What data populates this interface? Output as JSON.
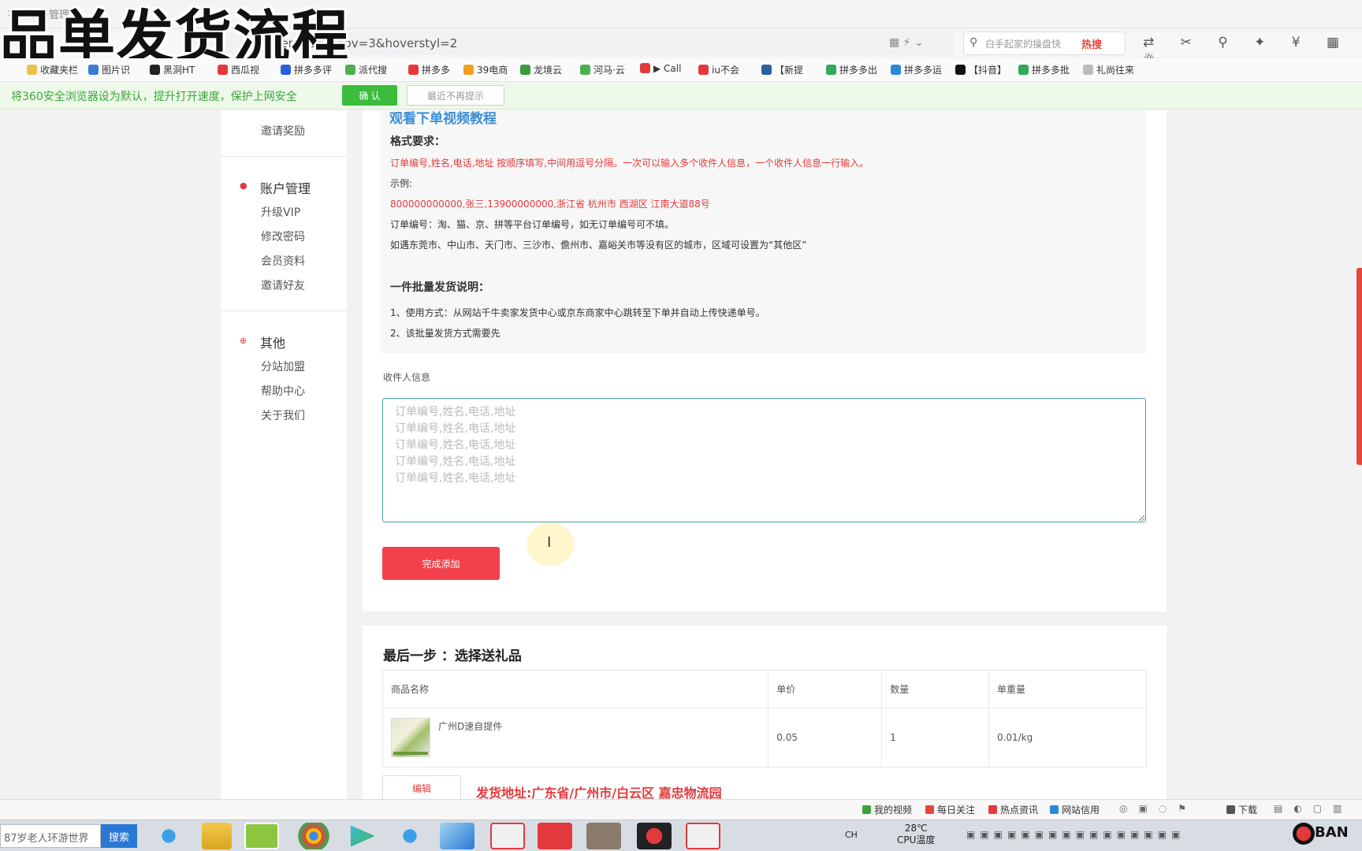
{
  "overlay_title": "品单发货流程",
  "browser": {
    "tab_ghost": "礼尚往来管理",
    "url": "eliverGoods?hov=3&hoverstyl=2",
    "search_placeholder": "白手起家的操盘快",
    "search_hot": "热搜",
    "bookmarks": [
      {
        "label": "收藏夹栏",
        "color": "#e8c24a"
      },
      {
        "label": "图片识",
        "color": "#3a7bd5"
      },
      {
        "label": "黑洞HT",
        "color": "#222222"
      },
      {
        "label": "西瓜视",
        "color": "#e4393c"
      },
      {
        "label": "拼多多评",
        "color": "#2b5fd9"
      },
      {
        "label": "派代搜",
        "color": "#4caf50"
      },
      {
        "label": "拼多多",
        "color": "#e4393c"
      },
      {
        "label": "39电商",
        "color": "#f0a020"
      },
      {
        "label": "龙境云",
        "color": "#3a9a3a"
      },
      {
        "label": "河马·云",
        "color": "#4caf50"
      },
      {
        "label": "▶ Call",
        "color": "#e4393c"
      },
      {
        "label": "iu不会",
        "color": "#e4393c"
      },
      {
        "label": "【新提",
        "color": "#2a5fa0"
      },
      {
        "label": "拼多多出",
        "color": "#2eaa5a"
      },
      {
        "label": "拼多多运",
        "color": "#2a8ad6"
      },
      {
        "label": "【抖音】",
        "color": "#111111"
      },
      {
        "label": "拼多多批",
        "color": "#2eaa5a"
      },
      {
        "label": "礼尚往来",
        "color": "#bbbbbb"
      }
    ],
    "infobar_text": "将360安全浏览器设为默认，提升打开速度，保护上网安全",
    "infobar_confirm": "确 认",
    "infobar_dismiss": "最近不再提示"
  },
  "sidebar": {
    "top_item": "邀请奖励",
    "sections": [
      {
        "title": "账户管理",
        "items": [
          "升级VIP",
          "修改密码",
          "会员资料",
          "邀请好友"
        ]
      },
      {
        "title": "其他",
        "items": [
          "分站加盟",
          "帮助中心",
          "关于我们"
        ]
      }
    ]
  },
  "notice": {
    "video_link": "观看下单视频教程",
    "format_title": "格式要求：",
    "format_rule": "订单编号,姓名,电话,地址 按顺序填写,中间用逗号分隔。一次可以输入多个收件人信息，一个收件人信息一行输入。",
    "example_label": "示例:",
    "example_value": "800000000000,张三,13900000000,浙江省 杭州市 西湖区 江南大道88号",
    "order_note": "订单编号：淘、猫、京、拼等平台订单编号，如无订单编号可不填。",
    "city_note": "如遇东莞市、中山市、天门市、三沙市、儋州市、嘉峪关市等没有区的城市，区域可设置为“其他区”",
    "batch_title": "一件批量发货说明：",
    "batch_1": "1、使用方式：从网站千牛卖家发货中心或京东商家中心跳转至下单并自动上传快递单号。",
    "batch_2": "2、该批量发货方式需要先"
  },
  "form": {
    "recipient_label": "收件人信息",
    "placeholder_lines": [
      "订单编号,姓名,电话,地址",
      "订单编号,姓名,电话,地址",
      "订单编号,姓名,电话,地址",
      "订单编号,姓名,电话,地址",
      "订单编号,姓名,电话,地址"
    ],
    "finish_button": "完成添加"
  },
  "gift_step": {
    "title": "最后一步 ：选择送礼品",
    "columns": [
      "商品名称",
      "单价",
      "数量",
      "单重量"
    ],
    "rows": [
      {
        "name": "广州D速自提件",
        "price": "0.05",
        "qty": "1",
        "weight": "0.01/kg"
      }
    ],
    "edit_button": "编辑",
    "ship_address": "发货地址:广东省/广州市/白云区 嘉忠物流园"
  },
  "statusbar": [
    {
      "label": "我的视频",
      "color": "#3aa43a"
    },
    {
      "label": "每日关注",
      "color": "#e8463b"
    },
    {
      "label": "热点资讯",
      "color": "#e4393c"
    },
    {
      "label": "网站信用",
      "color": "#2a8ad6"
    },
    {
      "label": "下载",
      "color": "#555555"
    }
  ],
  "taskbar": {
    "search_text": "87岁老人环游世界",
    "search_button": "搜索",
    "ime": "CH",
    "temperature": "28℃",
    "cpu_label": "CPU温度",
    "tray_text": "BAN"
  }
}
